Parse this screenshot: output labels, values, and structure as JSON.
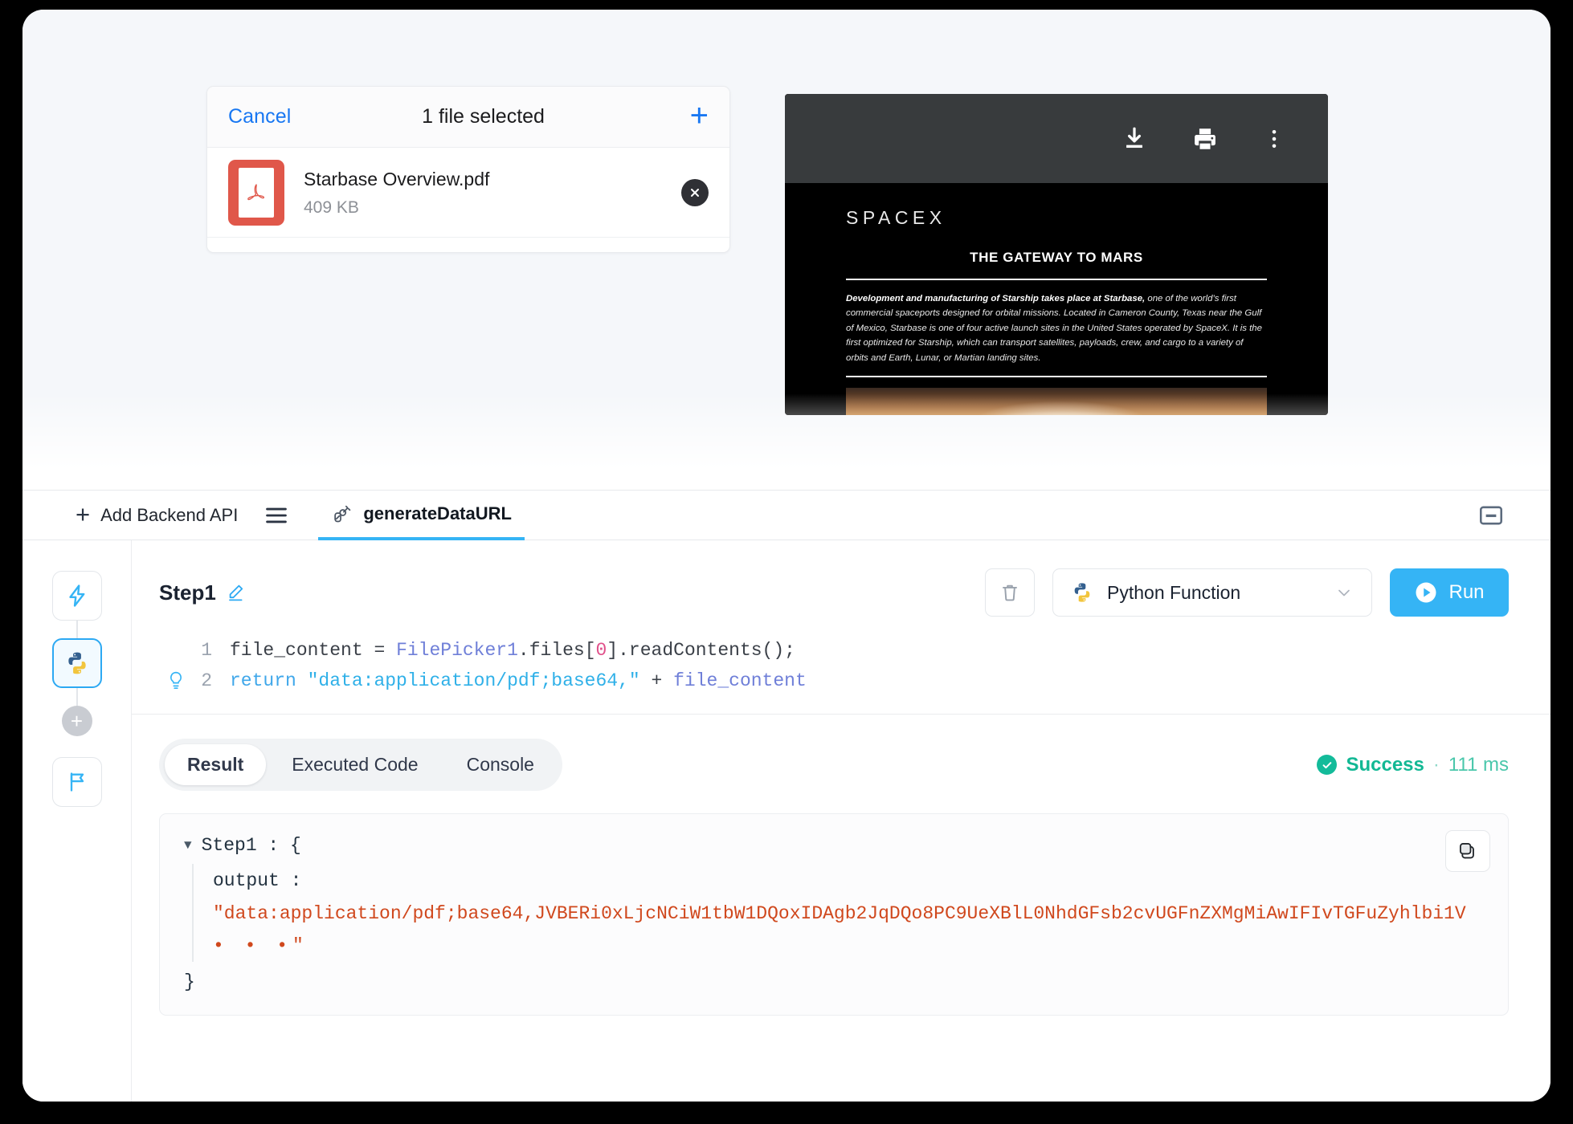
{
  "file_picker": {
    "cancel_label": "Cancel",
    "title": "1 file selected",
    "add_icon": "plus-icon",
    "file": {
      "name": "Starbase Overview.pdf",
      "size": "409 KB",
      "type_icon": "pdf-file-icon",
      "remove_icon": "close-circle-icon"
    }
  },
  "pdf_viewer": {
    "toolbar": {
      "download_icon": "download-icon",
      "print_icon": "print-icon",
      "more_icon": "more-vertical-icon"
    },
    "page": {
      "logo": "SPACEX",
      "heading": "THE GATEWAY TO MARS",
      "body_lead": "Development and manufacturing of Starship takes place at Starbase,",
      "body_rest": " one of the world’s first commercial spaceports designed for orbital missions. Located in Cameron County, Texas near the Gulf of Mexico, Starbase is one of four active launch sites in the United States operated by SpaceX. It is the first optimized for Starship, which can transport satellites, payloads, crew, and cargo to a variety of orbits and Earth, Lunar, or Martian landing sites."
    }
  },
  "editor": {
    "tabbar": {
      "add_api_label": "Add Backend API",
      "add_icon": "plus-icon",
      "menu_icon": "hamburger-menu-icon",
      "active_tab": {
        "label": "generateDataURL",
        "icon": "api-plug-icon"
      },
      "minimize_icon": "minimize-icon"
    },
    "rail": {
      "nodes": [
        {
          "name": "trigger-node",
          "icon": "lightning-bolt-icon",
          "selected": false
        },
        {
          "name": "python-node",
          "icon": "python-icon",
          "selected": true
        },
        {
          "name": "add-node",
          "icon": "plus-icon",
          "selected": false
        },
        {
          "name": "end-node",
          "icon": "flag-icon",
          "selected": false
        }
      ]
    },
    "step": {
      "title": "Step1",
      "edit_icon": "pencil-edit-icon",
      "delete_icon": "trash-icon",
      "language": "Python Function",
      "language_icon": "python-icon",
      "dropdown_icon": "chevron-down-icon",
      "run_label": "Run",
      "run_icon": "play-icon"
    },
    "code": {
      "lines": [
        {
          "number": "1",
          "hint": false,
          "tokens": [
            {
              "t": "file_content",
              "c": "var"
            },
            {
              "t": " = ",
              "c": "op"
            },
            {
              "t": "FilePicker1",
              "c": "id"
            },
            {
              "t": ".files[",
              "c": "prop"
            },
            {
              "t": "0",
              "c": "num"
            },
            {
              "t": "].readContents();",
              "c": "prop"
            }
          ]
        },
        {
          "number": "2",
          "hint": true,
          "hint_icon": "lightbulb-icon",
          "tokens": [
            {
              "t": "return ",
              "c": "kw"
            },
            {
              "t": "\"data:application/pdf;base64,\"",
              "c": "str"
            },
            {
              "t": " + ",
              "c": "op"
            },
            {
              "t": "file_content",
              "c": "id"
            }
          ]
        }
      ]
    },
    "result": {
      "tabs": [
        {
          "label": "Result",
          "active": true
        },
        {
          "label": "Executed Code",
          "active": false
        },
        {
          "label": "Console",
          "active": false
        }
      ],
      "status": {
        "icon": "check-circle-icon",
        "label": "Success",
        "separator": "·",
        "duration": "111 ms"
      },
      "copy_icon": "copy-icon",
      "output": {
        "root_label": "Step1 : {",
        "key_label": "output :",
        "value": "\"data:application/pdf;base64,JVBERi0xLjcNCiW1tbW1DQoxIDAgb2JqDQo8PC9UeXBlL0NhdGFsb2cvUGFnZXMgMiAwIFIvTGFuZyhlbi1V",
        "truncation": "• • •\"",
        "close_label": "}"
      }
    }
  },
  "colors": {
    "accent_blue": "#35b4f5",
    "link_blue": "#1877f2",
    "pdf_red": "#e0574a",
    "success_green": "#12b894",
    "string_orange": "#d0481d"
  }
}
